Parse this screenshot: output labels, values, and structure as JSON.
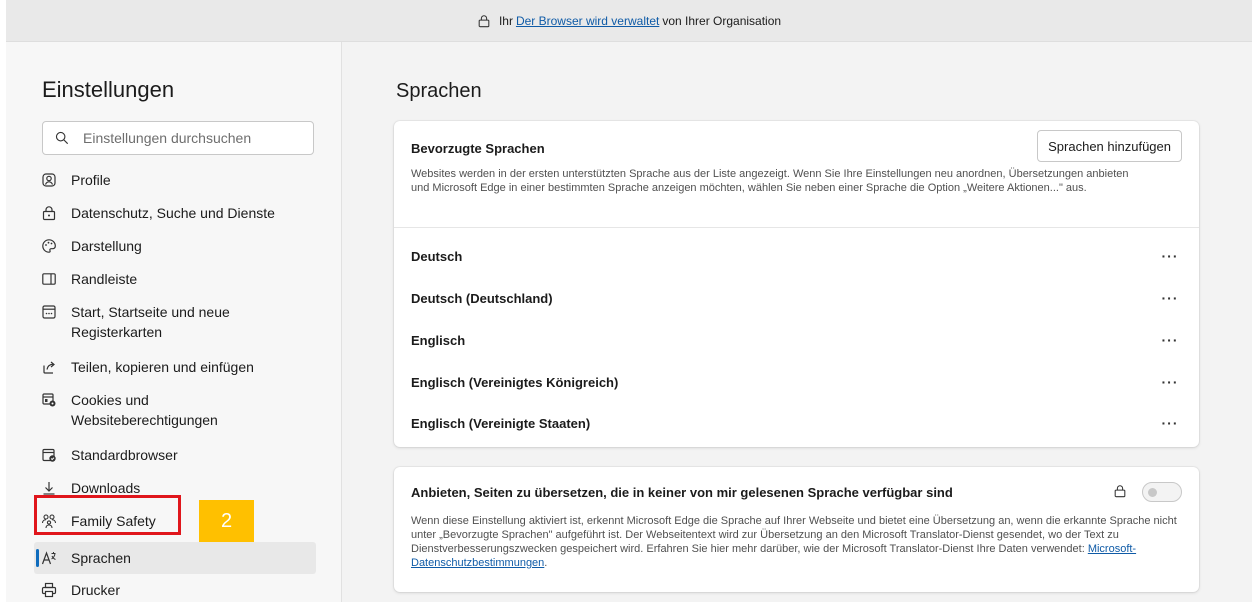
{
  "banner": {
    "prefix": "Ihr",
    "link": "Der Browser wird verwaltet",
    "suffix": "von Ihrer Organisation"
  },
  "sidebar": {
    "title": "Einstellungen",
    "search_placeholder": "Einstellungen durchsuchen",
    "items": [
      {
        "label": "Profile",
        "icon": "profile-icon"
      },
      {
        "label": "Datenschutz, Suche und Dienste",
        "icon": "lock-icon"
      },
      {
        "label": "Darstellung",
        "icon": "appearance-icon"
      },
      {
        "label": "Randleiste",
        "icon": "sidebar-panel-icon"
      },
      {
        "label": "Start, Startseite und neue Registerkarten",
        "icon": "start-page-icon"
      },
      {
        "label": "Teilen, kopieren und einfügen",
        "icon": "share-icon"
      },
      {
        "label": "Cookies und Websiteberechtigungen",
        "icon": "cookies-icon"
      },
      {
        "label": "Standardbrowser",
        "icon": "default-browser-icon"
      },
      {
        "label": "Downloads",
        "icon": "download-icon"
      },
      {
        "label": "Family Safety",
        "icon": "family-icon"
      },
      {
        "label": "Sprachen",
        "icon": "languages-icon",
        "active": true
      },
      {
        "label": "Drucker",
        "icon": "printer-icon"
      }
    ],
    "step_badge": "2"
  },
  "main": {
    "title": "Sprachen",
    "preferred": {
      "title": "Bevorzugte Sprachen",
      "add_button": "Sprachen hinzufügen",
      "description": "Websites werden in der ersten unterstützten Sprache aus der Liste angezeigt. Wenn Sie Ihre Einstellungen neu anordnen, Übersetzungen anbieten und Microsoft Edge in einer bestimmten Sprache anzeigen möchten, wählen Sie neben einer Sprache die Option „Weitere Aktionen...\" aus.",
      "languages": [
        "Deutsch",
        "Deutsch (Deutschland)",
        "Englisch",
        "Englisch (Vereinigtes Königreich)",
        "Englisch (Vereinigte Staaten)"
      ],
      "more_label": "···"
    },
    "offer": {
      "title": "Anbieten, Seiten zu übersetzen, die in keiner von mir gelesenen Sprache verfügbar sind",
      "toggle_on": false,
      "description": "Wenn diese Einstellung aktiviert ist, erkennt Microsoft Edge die Sprache auf Ihrer Webseite und bietet eine Übersetzung an, wenn die erkannte Sprache nicht unter „Bevorzugte Sprachen\" aufgeführt ist. Der Webseitentext wird zur Übersetzung an den Microsoft Translator-Dienst gesendet, wo der Text zu Dienstverbesserungszwecken gespeichert wird. Erfahren Sie hier mehr darüber, wie der Microsoft Translator-Dienst Ihre Daten verwendet:",
      "link": "Microsoft-Datenschutzbestimmungen",
      "link_suffix": "."
    }
  },
  "colors": {
    "accent": "#0f6cbd",
    "highlight": "#e0161c",
    "badge": "#ffc000",
    "link": "#0f5ba7"
  }
}
